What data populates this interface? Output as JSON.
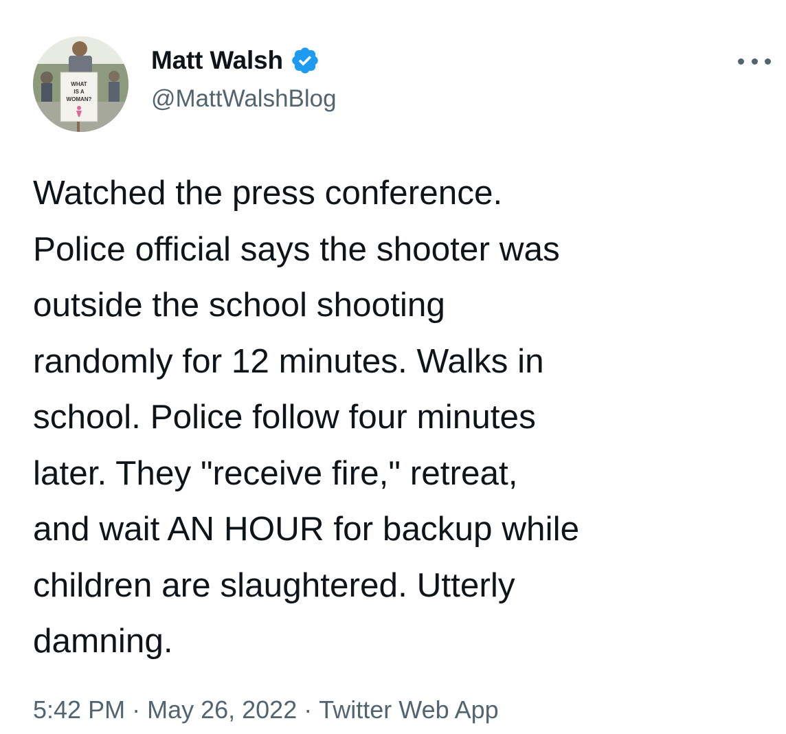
{
  "author": {
    "display_name": "Matt Walsh",
    "handle": "@MattWalshBlog",
    "verified": true,
    "avatar_sign_text": [
      "WHAT",
      "IS A",
      "WOMAN?"
    ]
  },
  "tweet": {
    "text": "Watched the press conference.\nPolice official says the shooter was\noutside the school shooting\nrandomly for 12 minutes. Walks in\nschool. Police follow four minutes\nlater. They \"receive fire,\" retreat,\nand wait AN HOUR for backup while\nchildren are slaughtered. Utterly\ndamning."
  },
  "meta": {
    "time": "5:42 PM",
    "date": "May 26, 2022",
    "source": "Twitter Web App",
    "separator": "·"
  },
  "icons": {
    "verified": "verified-badge-icon",
    "more": "more-options-icon"
  },
  "colors": {
    "text_primary": "#0f1419",
    "text_secondary": "#536471",
    "verified_blue": "#1d9bf0",
    "background": "#ffffff"
  }
}
